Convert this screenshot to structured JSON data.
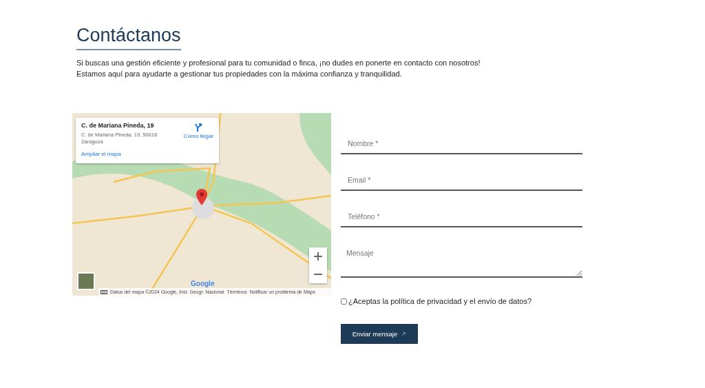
{
  "heading": "Contáctanos",
  "intro": [
    "Si buscas una gestión eficiente y profesional para tu comunidad o finca, ¡no dudes en ponerte en contacto con nosotros!",
    "Estamos aquí para ayudarte a gestionar tus propiedades con la máxima confianza y tranquilidad."
  ],
  "map": {
    "place_title": "C. de Mariana Pineda, 19",
    "address": [
      "C. de Mariana Pineda, 19, 50018",
      "Zaragoza"
    ],
    "directions": "Cómo llegar",
    "enlarge": "Ampliar el mapa",
    "logo": "Google",
    "attribution": "Datos del mapa ©2024 Google, Inst. Geogr. Nacional",
    "terms": "Términos",
    "report": "Notificar un problema de Maps"
  },
  "form": {
    "fields": [
      {
        "kind": "input",
        "placeholder": "Nombre *"
      },
      {
        "kind": "input",
        "placeholder": "Email *"
      },
      {
        "kind": "input",
        "placeholder": "Teléfono *"
      },
      {
        "kind": "textarea",
        "placeholder": "Mensaje"
      }
    ],
    "consent": {
      "label": "¿Aceptas la política de privacidad y el envío de datos?",
      "checked": false
    },
    "submit": {
      "label": "Enviar mensaje",
      "arrow": "↗"
    }
  }
}
